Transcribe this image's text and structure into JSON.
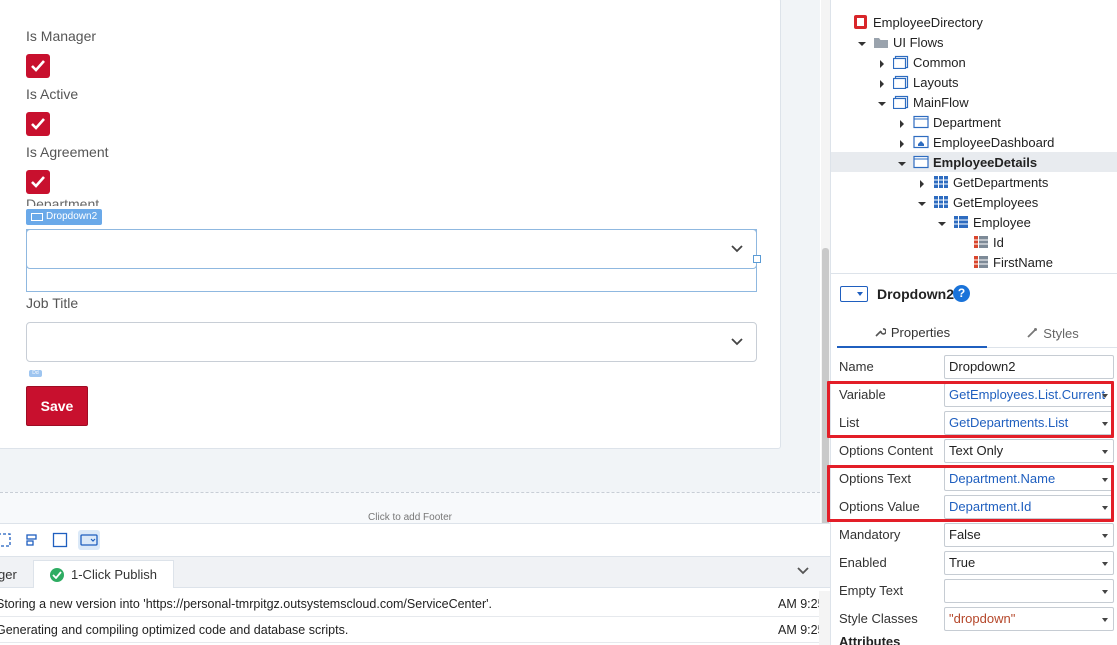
{
  "form": {
    "fields": [
      {
        "label": "Is Manager"
      },
      {
        "label": "Is Active"
      },
      {
        "label": "Is Agreement"
      }
    ],
    "hidden_label": "Department",
    "selected_widget_tag": "Dropdown2",
    "job_title_label": "Job Title",
    "save_label": "Save",
    "mini_tag": "Dd"
  },
  "canvas": {
    "footer_hint": "Click to add Footer"
  },
  "output": {
    "tabs": [
      {
        "label": "ger"
      },
      {
        "label": "1-Click Publish"
      }
    ],
    "logs": [
      {
        "message": "Storing a new version into 'https://personal-tmrpitgz.outsystemscloud.com/ServiceCenter'.",
        "time": "AM 9:25"
      },
      {
        "message": "Generating and compiling optimized code and database scripts.",
        "time": "AM 9:25"
      }
    ]
  },
  "tree": {
    "items": [
      {
        "label": "EmployeeDirectory",
        "icon": "app-icon",
        "depth": 0,
        "arrow": "none"
      },
      {
        "label": "UI Flows",
        "icon": "folder-icon",
        "depth": 1,
        "arrow": "down"
      },
      {
        "label": "Common",
        "icon": "flow-icon",
        "depth": 2,
        "arrow": "right"
      },
      {
        "label": "Layouts",
        "icon": "flow-icon",
        "depth": 2,
        "arrow": "right"
      },
      {
        "label": "MainFlow",
        "icon": "flow-icon",
        "depth": 2,
        "arrow": "down"
      },
      {
        "label": "Department",
        "icon": "screen-icon",
        "depth": 3,
        "arrow": "right"
      },
      {
        "label": "EmployeeDashboard",
        "icon": "home-screen-icon",
        "depth": 3,
        "arrow": "right"
      },
      {
        "label": "EmployeeDetails",
        "icon": "screen-icon",
        "depth": 3,
        "arrow": "down",
        "selected": true
      },
      {
        "label": "GetDepartments",
        "icon": "aggregate-icon",
        "depth": 4,
        "arrow": "right"
      },
      {
        "label": "GetEmployees",
        "icon": "aggregate-icon",
        "depth": 4,
        "arrow": "down"
      },
      {
        "label": "Employee",
        "icon": "entity-icon",
        "depth": 5,
        "arrow": "down"
      },
      {
        "label": "Id",
        "icon": "attribute-icon",
        "depth": 6,
        "arrow": "none"
      },
      {
        "label": "FirstName",
        "icon": "attribute-icon",
        "depth": 6,
        "arrow": "none"
      }
    ]
  },
  "properties": {
    "widget_name": "Dropdown2",
    "help": "?",
    "tab_properties": "Properties",
    "tab_styles": "Styles",
    "rows": [
      {
        "label": "Name",
        "value": "Dropdown2",
        "kind": "plain",
        "dropdown": false
      },
      {
        "label": "Variable",
        "value": "GetEmployees.List.Current",
        "kind": "link",
        "dropdown": true
      },
      {
        "label": "List",
        "value": "GetDepartments.List",
        "kind": "link",
        "dropdown": true
      },
      {
        "label": "Options Content",
        "value": "Text Only",
        "kind": "plain",
        "dropdown": true
      },
      {
        "label": "Options Text",
        "value": "Department.Name",
        "kind": "link",
        "dropdown": true
      },
      {
        "label": "Options Value",
        "value": "Department.Id",
        "kind": "link",
        "dropdown": true
      },
      {
        "label": "Mandatory",
        "value": "False",
        "kind": "plain",
        "dropdown": true
      },
      {
        "label": "Enabled",
        "value": "True",
        "kind": "plain",
        "dropdown": true
      },
      {
        "label": "Empty Text",
        "value": "",
        "kind": "plain",
        "dropdown": true
      },
      {
        "label": "Style Classes",
        "value": "\"dropdown\"",
        "kind": "str",
        "dropdown": true
      }
    ],
    "attributes_title": "Attributes"
  },
  "colors": {
    "brand_red": "#c8102e",
    "link_blue": "#1f5fbf",
    "highlight_red": "#e31e28",
    "success_green": "#2eac62"
  }
}
